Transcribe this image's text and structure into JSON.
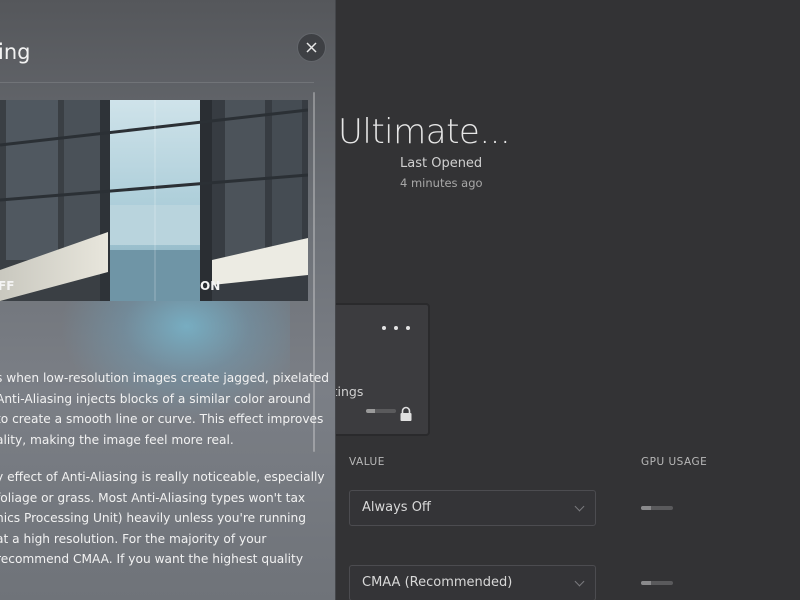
{
  "game": {
    "title": "Ultimate...",
    "last_opened_label": "Last Opened",
    "last_opened_value": "4 minutes ago"
  },
  "profile_card": {
    "label": "ettings"
  },
  "table": {
    "headers": {
      "value": "VALUE",
      "gpu_usage": "GPU USAGE"
    },
    "rows": [
      {
        "value": "Always Off",
        "gpu_usage": 0.3
      },
      {
        "value": "CMAA (Recommended)",
        "gpu_usage": 0.3
      }
    ]
  },
  "panel": {
    "title": "ing",
    "comparison": {
      "label_off": "FF",
      "label_on": "ON"
    },
    "paragraph_1": "s when low-resolution images create jagged, pixelated\nAnti-Aliasing injects blocks of a similar color around\nto create a smooth line or curve. This effect improves\nality, making the image feel more real.",
    "paragraph_2": "y effect of Anti-Aliasing is really noticeable, especially\nfoliage or grass. Most Anti-Aliasing types won't tax\nhics Processing Unit) heavily unless you're running\nat a high resolution. For the majority of your\nrecommend CMAA. If you want the highest quality"
  },
  "colors": {
    "background": "#333335",
    "panel_top": "#55575b",
    "panel_bottom": "#7b7f86",
    "glow": "#78bed7",
    "text": "#f2f2f2"
  },
  "icons": [
    "close-icon",
    "more-options-icon",
    "lock-icon",
    "chevron-down-icon"
  ]
}
